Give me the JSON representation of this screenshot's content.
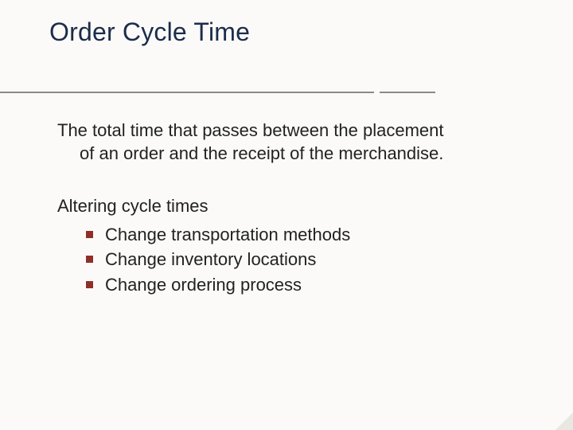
{
  "title": "Order Cycle Time",
  "definition": {
    "line1": "The total time that passes between the placement",
    "line2": "of an order and the receipt of the merchandise."
  },
  "altering": {
    "heading": "Altering cycle times",
    "items": [
      "Change transportation methods",
      "Change inventory locations",
      "Change ordering process"
    ]
  }
}
